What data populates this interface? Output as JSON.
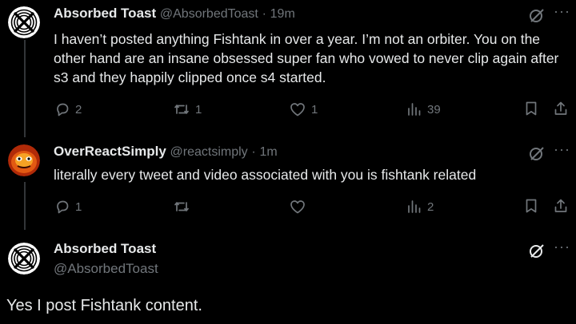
{
  "tweets": [
    {
      "name": "Absorbed Toast",
      "handle": "@AbsorbedToast",
      "time": "19m",
      "text": "I haven’t posted anything Fishtank in over a year. I’m not an orbiter. You on the other hand are an insane obsessed super fan who vowed to never clip again after s3 and they happily clipped once s4 started.",
      "replies": "2",
      "reposts": "1",
      "likes": "1",
      "views": "39"
    },
    {
      "name": "OverReactSimply",
      "handle": "@reactsimply",
      "time": "1m",
      "text": "literally every tweet and video associated with you is fishtank related",
      "replies": "1",
      "reposts": "",
      "likes": "",
      "views": "2"
    }
  ],
  "main_tweet": {
    "name": "Absorbed Toast",
    "handle": "@AbsorbedToast",
    "text": "Yes I post Fishtank content."
  },
  "separator": "·",
  "colors": {
    "text": "#e7e9ea",
    "muted": "#71767b",
    "line": "#333639",
    "background": "#000000"
  }
}
